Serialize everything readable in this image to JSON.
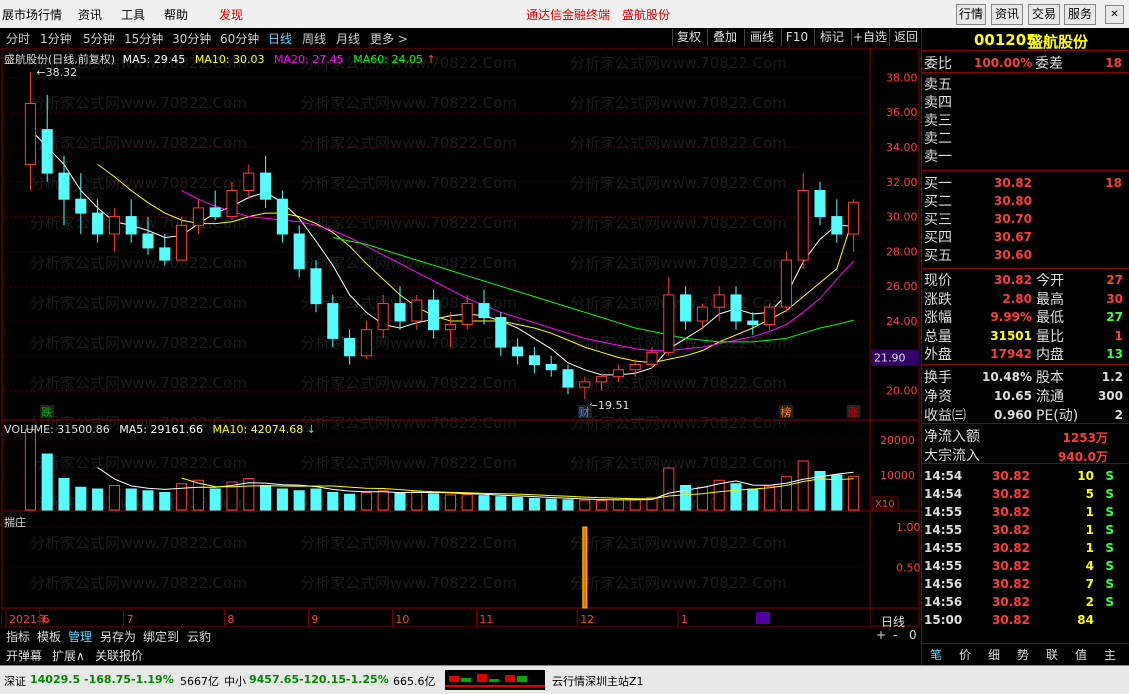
{
  "menubar": {
    "items": [
      "展市场行情",
      "资讯",
      "工具",
      "帮助",
      "发现"
    ],
    "title": "通达信金融终端　盛航股份",
    "right_buttons": [
      "行情",
      "资讯",
      "交易",
      "服务"
    ]
  },
  "period_tabs": [
    "分时",
    "1分钟",
    "5分钟",
    "15分钟",
    "30分钟",
    "60分钟",
    "日线",
    "周线",
    "月线",
    "更多 >"
  ],
  "toolbar": [
    "复权",
    "叠加",
    "画线",
    "F10",
    "标记",
    "+自选",
    "返回"
  ],
  "chart_data": [
    {
      "type": "candlestick",
      "title": "盛航股份(日线,前复权)",
      "indicators": [
        {
          "name": "MA5",
          "value": "29.45",
          "color": "#ffffff"
        },
        {
          "name": "MA10",
          "value": "30.03",
          "color": "#ffff00"
        },
        {
          "name": "MA20",
          "value": "27.45",
          "color": "#ff00ff"
        },
        {
          "name": "MA60",
          "value": "24.05",
          "color": "#00ff00"
        }
      ],
      "ylim": [
        19.0,
        39.0
      ],
      "y_ticks": [
        "38.00",
        "36.00",
        "34.00",
        "32.00",
        "30.00",
        "28.00",
        "26.00",
        "24.00",
        "22.00",
        "20.00"
      ],
      "annotations": {
        "high": "38.32",
        "low": "19.51",
        "cursor_price": "21.90"
      },
      "event_marks": [
        "跌",
        "财",
        "榜",
        "涨"
      ],
      "x_months": [
        "2021年",
        "6",
        "7",
        "8",
        "9",
        "10",
        "11",
        "12",
        "1"
      ],
      "ohlc": [
        [
          33.0,
          38.32,
          31.5,
          36.5
        ],
        [
          35.0,
          37.0,
          32.0,
          32.5
        ],
        [
          32.5,
          33.5,
          29.5,
          31.0
        ],
        [
          31.0,
          32.5,
          29.0,
          30.2
        ],
        [
          30.2,
          31.0,
          28.5,
          29.0
        ],
        [
          29.0,
          30.5,
          28.0,
          30.0
        ],
        [
          30.0,
          31.0,
          28.5,
          29.0
        ],
        [
          29.0,
          30.0,
          27.8,
          28.2
        ],
        [
          28.2,
          29.0,
          27.2,
          27.5
        ],
        [
          27.5,
          30.0,
          27.5,
          29.5
        ],
        [
          29.5,
          31.0,
          29.0,
          30.5
        ],
        [
          30.5,
          31.5,
          29.8,
          30.0
        ],
        [
          30.0,
          32.0,
          29.8,
          31.5
        ],
        [
          31.5,
          33.0,
          31.0,
          32.5
        ],
        [
          32.5,
          33.5,
          30.5,
          31.0
        ],
        [
          31.0,
          31.5,
          28.5,
          29.0
        ],
        [
          29.0,
          29.5,
          26.5,
          27.0
        ],
        [
          27.0,
          27.5,
          24.5,
          25.0
        ],
        [
          25.0,
          25.5,
          22.5,
          23.0
        ],
        [
          23.0,
          23.5,
          21.5,
          22.0
        ],
        [
          22.0,
          24.0,
          21.8,
          23.5
        ],
        [
          23.5,
          25.5,
          23.0,
          25.0
        ],
        [
          25.0,
          26.0,
          23.5,
          24.0
        ],
        [
          24.0,
          25.5,
          23.5,
          25.2
        ],
        [
          25.2,
          25.8,
          23.0,
          23.5
        ],
        [
          23.5,
          24.5,
          22.5,
          23.8
        ],
        [
          23.8,
          25.5,
          23.5,
          25.0
        ],
        [
          25.0,
          25.8,
          23.8,
          24.2
        ],
        [
          24.2,
          24.5,
          22.0,
          22.5
        ],
        [
          22.5,
          23.0,
          21.5,
          22.0
        ],
        [
          22.0,
          22.5,
          21.0,
          21.5
        ],
        [
          21.5,
          22.0,
          20.8,
          21.2
        ],
        [
          21.2,
          21.5,
          19.8,
          20.2
        ],
        [
          20.2,
          20.8,
          19.51,
          20.5
        ],
        [
          20.5,
          21.0,
          20.0,
          20.8
        ],
        [
          20.8,
          21.5,
          20.5,
          21.2
        ],
        [
          21.2,
          21.8,
          20.8,
          21.5
        ],
        [
          21.5,
          22.5,
          21.3,
          22.2
        ],
        [
          22.2,
          26.5,
          22.0,
          25.5
        ],
        [
          25.5,
          26.0,
          23.5,
          24.0
        ],
        [
          24.0,
          25.0,
          23.5,
          24.8
        ],
        [
          24.8,
          26.0,
          24.0,
          25.5
        ],
        [
          25.5,
          26.0,
          23.5,
          24.0
        ],
        [
          24.0,
          24.5,
          23.2,
          23.8
        ],
        [
          23.8,
          25.0,
          23.5,
          24.8
        ],
        [
          24.8,
          28.0,
          24.5,
          27.5
        ],
        [
          27.5,
          32.5,
          27.0,
          31.5
        ],
        [
          31.5,
          32.0,
          29.5,
          30.0
        ],
        [
          30.0,
          31.0,
          28.5,
          29.0
        ],
        [
          29.0,
          31.0,
          28.0,
          30.82
        ]
      ],
      "ma_series": {
        "MA5": [
          35.0,
          34.0,
          33.0,
          31.5,
          30.5,
          29.7,
          29.5,
          29.2,
          28.8,
          28.9,
          29.6,
          30.2,
          30.6,
          31.1,
          31.4,
          30.8,
          29.9,
          28.6,
          27.2,
          25.5,
          24.5,
          23.8,
          23.6,
          23.9,
          24.1,
          24.3,
          24.4,
          24.3,
          24.0,
          23.6,
          23.0,
          22.4,
          21.6,
          21.2,
          20.9,
          20.9,
          21.0,
          21.3,
          22.4,
          23.0,
          23.6,
          24.4,
          24.7,
          24.4,
          24.5,
          25.5,
          27.4,
          28.7,
          29.5,
          29.45
        ],
        "MA10": [
          null,
          null,
          null,
          null,
          33.0,
          32.3,
          31.5,
          30.8,
          30.2,
          29.8,
          29.6,
          29.6,
          29.7,
          30.0,
          30.2,
          30.2,
          30.0,
          29.6,
          29.1,
          28.3,
          27.3,
          26.4,
          25.5,
          24.8,
          24.3,
          24.0,
          24.0,
          24.0,
          24.0,
          23.8,
          23.6,
          23.3,
          22.9,
          22.5,
          22.2,
          21.9,
          21.7,
          21.6,
          21.8,
          22.0,
          22.3,
          22.8,
          23.2,
          23.6,
          24.1,
          24.6,
          25.4,
          26.2,
          27.0,
          30.03
        ],
        "MA20": [
          null,
          null,
          null,
          null,
          null,
          null,
          null,
          null,
          null,
          31.5,
          31.0,
          30.6,
          30.3,
          30.0,
          29.9,
          29.8,
          29.7,
          29.5,
          29.2,
          28.8,
          28.3,
          27.8,
          27.3,
          26.8,
          26.3,
          25.8,
          25.3,
          24.9,
          24.5,
          24.2,
          23.9,
          23.6,
          23.3,
          23.0,
          22.8,
          22.6,
          22.4,
          22.3,
          22.3,
          22.4,
          22.5,
          22.7,
          22.9,
          23.1,
          23.4,
          23.8,
          24.5,
          25.3,
          26.4,
          27.45
        ],
        "MA60": [
          null,
          null,
          null,
          null,
          null,
          null,
          null,
          null,
          null,
          null,
          null,
          null,
          null,
          null,
          null,
          null,
          null,
          null,
          28.8,
          28.6,
          28.4,
          28.1,
          27.8,
          27.5,
          27.2,
          26.9,
          26.6,
          26.3,
          26.0,
          25.7,
          25.4,
          25.1,
          24.8,
          24.5,
          24.2,
          23.9,
          23.6,
          23.4,
          23.2,
          23.0,
          22.9,
          22.8,
          22.8,
          22.8,
          22.9,
          23.0,
          23.3,
          23.6,
          23.8,
          24.05
        ]
      }
    },
    {
      "type": "bar",
      "title": "VOLUME",
      "values_label": "31500.86",
      "indicators": [
        {
          "name": "MA5",
          "value": "29161.66",
          "color": "#ffffff"
        },
        {
          "name": "MA10",
          "value": "42074.68",
          "color": "#ffff00"
        }
      ],
      "y_ticks": [
        "20000",
        "10000"
      ],
      "unit_label": "X10",
      "values": [
        23000,
        16000,
        9000,
        6500,
        6000,
        7000,
        6000,
        5500,
        5000,
        7500,
        8500,
        6000,
        8000,
        9000,
        7000,
        6000,
        5500,
        6000,
        5000,
        4500,
        5000,
        5500,
        4800,
        5200,
        4600,
        4300,
        4400,
        4100,
        3800,
        3600,
        3300,
        3100,
        2900,
        2800,
        2700,
        2900,
        3100,
        3500,
        12000,
        7000,
        6500,
        8500,
        7500,
        6000,
        6800,
        9500,
        14000,
        11000,
        10000,
        9500
      ]
    },
    {
      "type": "bar",
      "title": "揣庄",
      "y_ticks": [
        "1.00",
        "0.50"
      ],
      "values": [
        0,
        0,
        0,
        0,
        0,
        0,
        0,
        0,
        0,
        0,
        0,
        0,
        0,
        0,
        0,
        0,
        0,
        0,
        0,
        0,
        0,
        0,
        0,
        0,
        0,
        0,
        0,
        0,
        0,
        0,
        0,
        0,
        0,
        1,
        0,
        0,
        0,
        0,
        0,
        0,
        0,
        0,
        0,
        0,
        0,
        0,
        0,
        0,
        0,
        0
      ]
    }
  ],
  "watermark": "分析家公式网www.70822.Com",
  "right_panel": {
    "code": "001205",
    "name": "盛航股份",
    "weibi_label": "委比",
    "weibi": "100.00%",
    "weicha_label": "委差",
    "weicha": "18",
    "sell": [
      {
        "label": "卖五"
      },
      {
        "label": "卖四"
      },
      {
        "label": "卖三"
      },
      {
        "label": "卖二"
      },
      {
        "label": "卖一"
      }
    ],
    "buy": [
      {
        "label": "买一",
        "price": "30.82",
        "vol": "18"
      },
      {
        "label": "买二",
        "price": "30.80",
        "vol": ""
      },
      {
        "label": "买三",
        "price": "30.70",
        "vol": ""
      },
      {
        "label": "买四",
        "price": "30.67",
        "vol": ""
      },
      {
        "label": "买五",
        "price": "30.60",
        "vol": ""
      }
    ],
    "quote": [
      {
        "l1": "现价",
        "v1": "30.82",
        "l2": "今开",
        "v2": "27"
      },
      {
        "l1": "涨跌",
        "v1": "2.80",
        "l2": "最高",
        "v2": "30"
      },
      {
        "l1": "涨幅",
        "v1": "9.99%",
        "l2": "最低",
        "v2": "27"
      },
      {
        "l1": "总量",
        "v1": "31501",
        "l2": "量比",
        "v2": "1"
      },
      {
        "l1": "外盘",
        "v1": "17942",
        "l2": "内盘",
        "v2": "13"
      }
    ],
    "stats": [
      {
        "l1": "换手",
        "v1": "10.48%",
        "l2": "股本",
        "v2": "1.2"
      },
      {
        "l1": "净资",
        "v1": "10.65",
        "l2": "流通",
        "v2": "300"
      },
      {
        "l1": "收益㈢",
        "v1": "0.960",
        "l2": "PE(动)",
        "v2": "2"
      }
    ],
    "flow": [
      {
        "label": "净流入额",
        "value": "1253万"
      },
      {
        "label": "大宗流入",
        "value": "940.0万"
      }
    ],
    "ticks": [
      {
        "t": "14:54",
        "p": "30.82",
        "v": "10",
        "s": "S"
      },
      {
        "t": "14:54",
        "p": "30.82",
        "v": "5",
        "s": "S"
      },
      {
        "t": "14:55",
        "p": "30.82",
        "v": "1",
        "s": "S"
      },
      {
        "t": "14:55",
        "p": "30.82",
        "v": "1",
        "s": "S"
      },
      {
        "t": "14:55",
        "p": "30.82",
        "v": "1",
        "s": "S"
      },
      {
        "t": "14:55",
        "p": "30.82",
        "v": "4",
        "s": "S"
      },
      {
        "t": "14:56",
        "p": "30.82",
        "v": "7",
        "s": "S"
      },
      {
        "t": "14:56",
        "p": "30.82",
        "v": "2",
        "s": "S"
      },
      {
        "t": "15:00",
        "p": "30.82",
        "v": "84",
        "s": ""
      }
    ],
    "tabs": [
      "笔",
      "价",
      "细",
      "势",
      "联",
      "值",
      "主"
    ]
  },
  "bottom_buttons": [
    "指标",
    "模板",
    "管理",
    "另存为",
    "绑定到",
    "云豹"
  ],
  "bottom_buttons2": [
    "开弹幕",
    "扩展∧",
    "关联报价"
  ],
  "period_label": "日线",
  "zoom": [
    "+",
    "-",
    "0"
  ],
  "statusbar": {
    "sz_label": "深证",
    "sz_index": "14029.5",
    "sz_chg": "-168.75",
    "sz_pct": "-1.19%",
    "sz_amt": "5667亿",
    "zx_label": "中小",
    "zx_index": "9457.65",
    "zx_chg": "-120.15",
    "zx_pct": "-1.25%",
    "zx_amt": "665.6亿",
    "server": "云行情深圳主站Z1"
  }
}
